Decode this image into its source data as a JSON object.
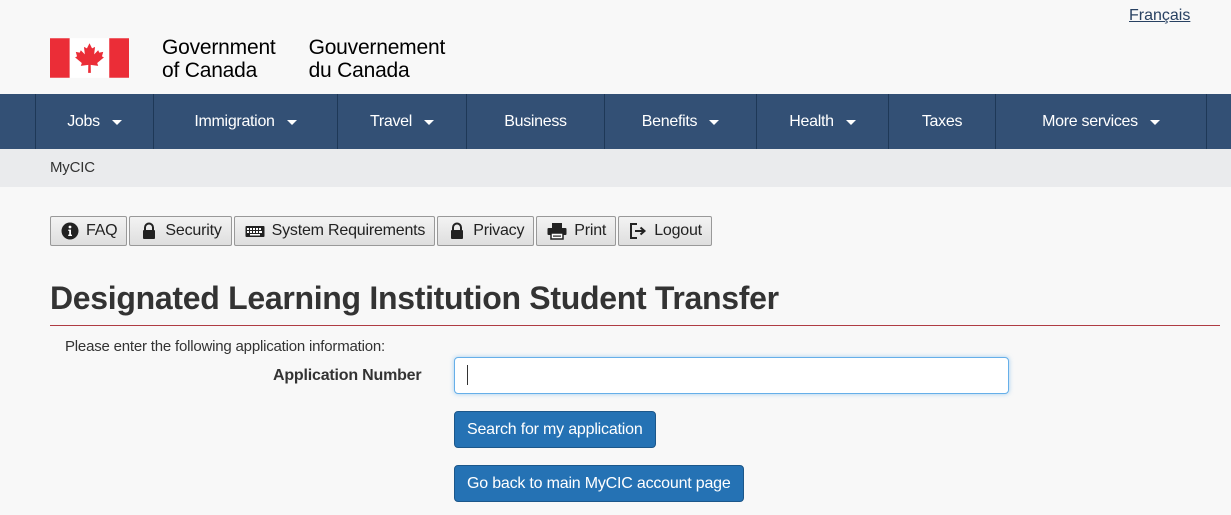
{
  "header": {
    "language_link": "Français",
    "signature_en_line1": "Government",
    "signature_en_line2": "of Canada",
    "signature_fr_line1": "Gouvernement",
    "signature_fr_line2": "du Canada",
    "flag_icon": "canada-flag-icon",
    "flag_red": "#eb2d37"
  },
  "nav": {
    "background": "#335075",
    "items": [
      {
        "label": "Jobs",
        "dropdown": true
      },
      {
        "label": "Immigration",
        "dropdown": true
      },
      {
        "label": "Travel",
        "dropdown": true
      },
      {
        "label": "Business",
        "dropdown": false
      },
      {
        "label": "Benefits",
        "dropdown": true
      },
      {
        "label": "Health",
        "dropdown": true
      },
      {
        "label": "Taxes",
        "dropdown": false
      },
      {
        "label": "More services",
        "dropdown": true
      }
    ]
  },
  "breadcrumb": {
    "label": "MyCIC"
  },
  "toolbar": {
    "items": [
      {
        "label": "FAQ",
        "icon": "info-icon"
      },
      {
        "label": "Security",
        "icon": "lock-icon"
      },
      {
        "label": "System Requirements",
        "icon": "keyboard-icon"
      },
      {
        "label": "Privacy",
        "icon": "lock-icon"
      },
      {
        "label": "Print",
        "icon": "printer-icon"
      },
      {
        "label": "Logout",
        "icon": "logout-icon"
      }
    ]
  },
  "main": {
    "title": "Designated Learning Institution Student Transfer",
    "title_rule_color": "#af3c43",
    "intro": "Please enter the following application information:",
    "application_number_label": "Application Number",
    "application_number_value": "",
    "search_button": "Search for my application",
    "back_button": "Go back to main MyCIC account page",
    "button_color": "#2572b4"
  }
}
